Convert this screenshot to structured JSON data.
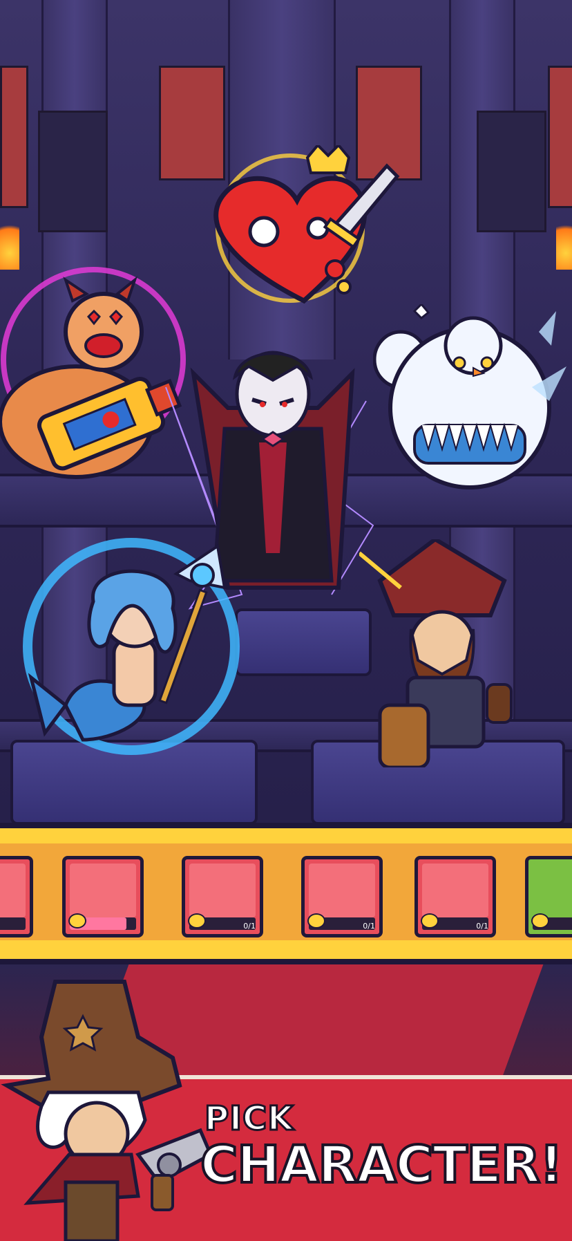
{
  "screen": "character-select-promo",
  "headline": {
    "line1": "PICK",
    "line2": "CHARACTER!"
  },
  "roster": {
    "cards": [
      {
        "name": "snow-queen-card",
        "count": "",
        "progress": 0.35,
        "face": "#f36f7a"
      },
      {
        "name": "mermaid-card",
        "count": "",
        "progress": 0.85,
        "face": "#f36f7a"
      },
      {
        "name": "old-sage-card",
        "count": "0/1",
        "progress": 0,
        "face": "#f36f7a"
      },
      {
        "name": "pig-demon-card",
        "count": "0/1",
        "progress": 0,
        "face": "#f36f7a"
      },
      {
        "name": "cowboy-card",
        "count": "0/1",
        "progress": 0,
        "face": "#f36f7a"
      },
      {
        "name": "heart-knight-card",
        "count": "",
        "progress": 0,
        "face": "#7bc043"
      }
    ]
  },
  "colors": {
    "strip": "#ffd23d",
    "card": "#e84e5c",
    "carpet": "#b8283f",
    "band": "#d42b3e"
  },
  "characters": [
    "heart-king",
    "pig-demon",
    "vampire",
    "snow-golem",
    "mermaid",
    "pirate",
    "cowboy"
  ]
}
